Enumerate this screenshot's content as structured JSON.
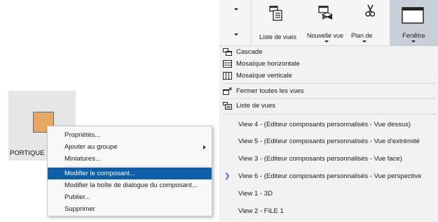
{
  "component": {
    "label": "PORTIQUE"
  },
  "context_menu": {
    "items": [
      {
        "label": "Propriétés..."
      },
      {
        "label": "Ajouter au groupe"
      },
      {
        "label": "Miniatures..."
      },
      {
        "label": "Modifier le composant..."
      },
      {
        "label": "Modifier la boîte de dialogue du composant..."
      },
      {
        "label": "Publier..."
      },
      {
        "label": "Supprimer"
      }
    ],
    "highlighted": "Modifier le composant..."
  },
  "ribbon": {
    "buttons": [
      {
        "label": "Liste de vues",
        "icon": "view-list-icon"
      },
      {
        "label": "Nouvelle vue",
        "icon": "new-view-icon"
      },
      {
        "label": "Plan de",
        "icon": "scissors-icon"
      },
      {
        "label": "Fenêtre",
        "icon": "window-icon"
      }
    ]
  },
  "window_menu": {
    "items": [
      {
        "label": "Cascade",
        "icon": "cascade-icon"
      },
      {
        "label": "Mosaïque horizontale",
        "icon": "tile-horizontal-icon"
      },
      {
        "label": "Mosaïque verticale",
        "icon": "tile-vertical-icon"
      },
      {
        "label": "Fermer toutes les vues",
        "icon": "close-all-views-icon"
      },
      {
        "label": "Liste de vues",
        "icon": "view-list-icon"
      }
    ],
    "views": [
      {
        "label": "View 4 - (Editeur composants personnalisés - Vue dessus)",
        "active": false
      },
      {
        "label": "View 5 - (Editeur composants personnalisés - Vue d'extrémité",
        "active": false
      },
      {
        "label": "View 3 - (Editeur composants personnalisés - Vue face)",
        "active": false
      },
      {
        "label": "View 6 - (Editeur composants personnalisés - Vue perspective",
        "active": true
      },
      {
        "label": "View 1 - 3D",
        "active": false
      },
      {
        "label": "View 2 - FILE 1",
        "active": false
      }
    ]
  },
  "colors": {
    "highlight": "#0f5fa8",
    "active_chevron": "#2b78c8",
    "component_fill": "#e9a860"
  }
}
